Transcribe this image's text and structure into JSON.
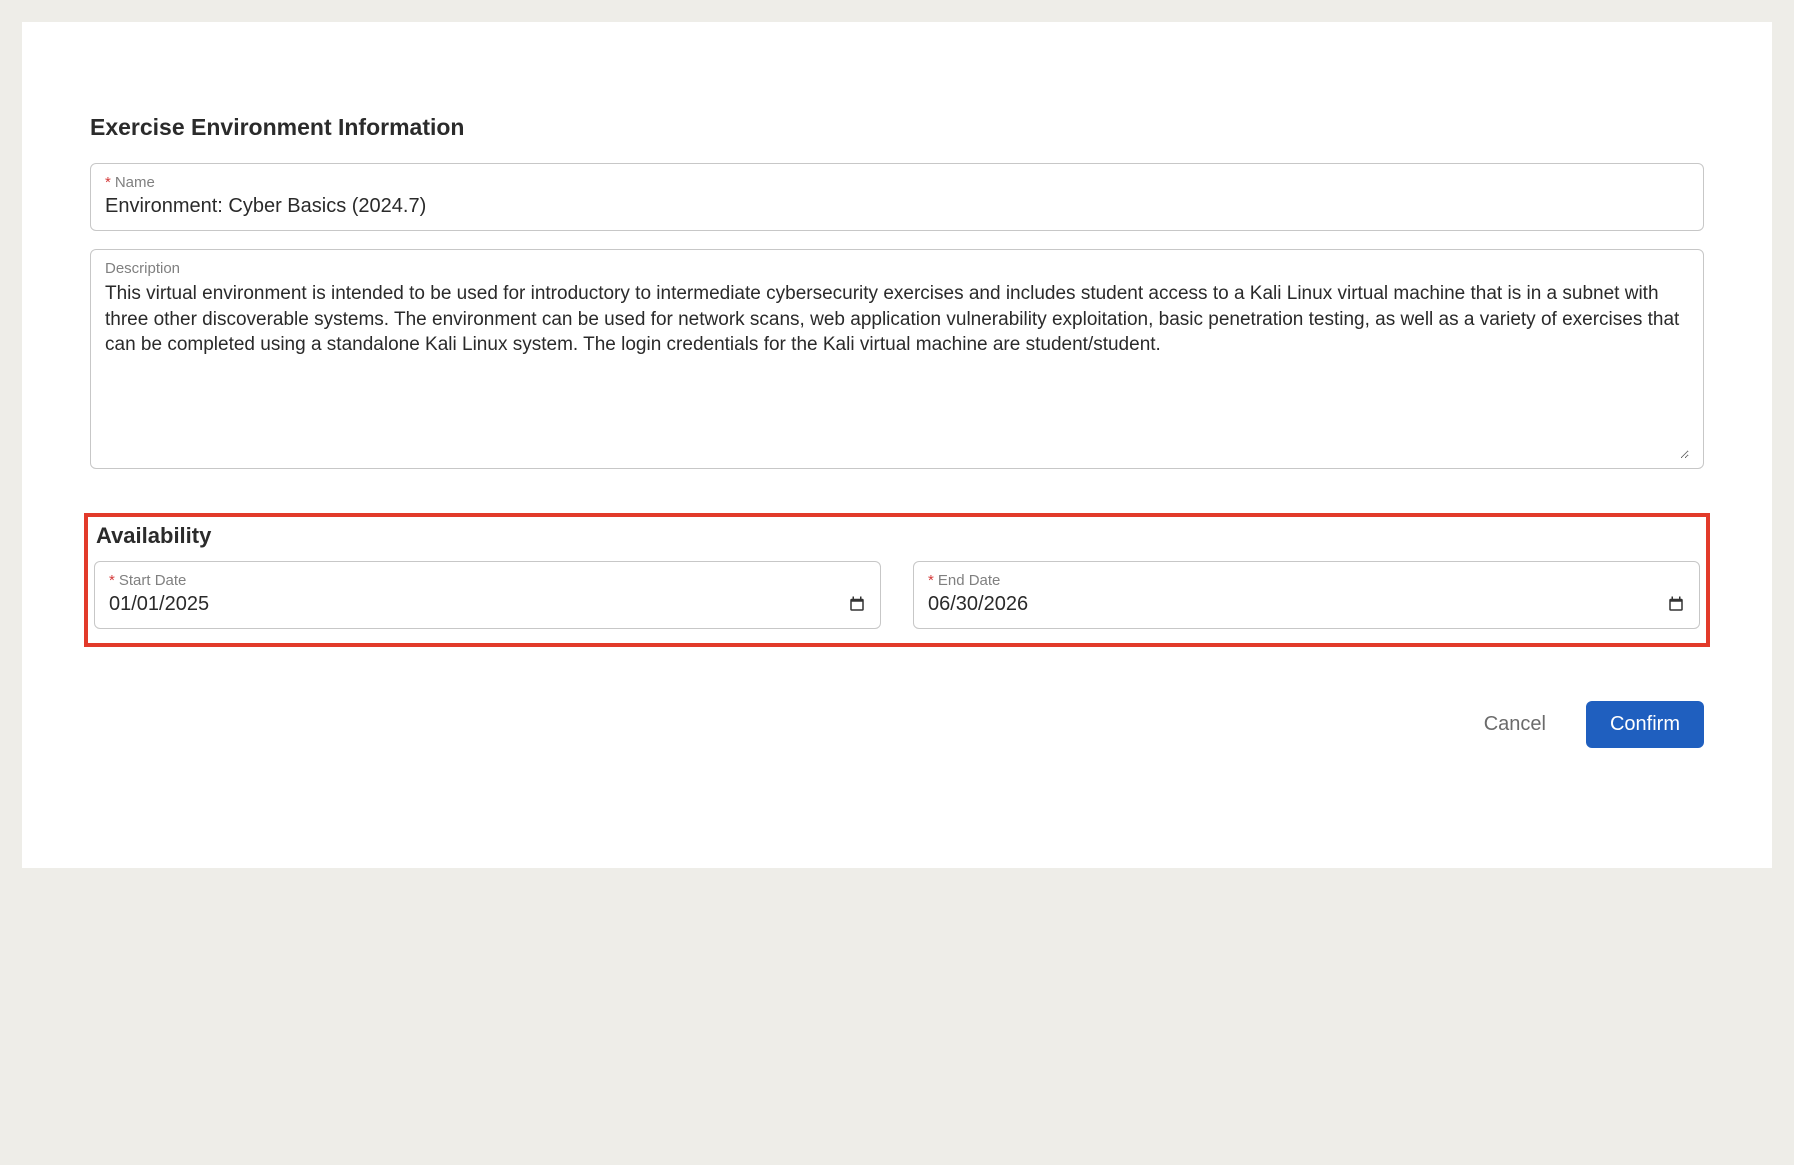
{
  "envInfo": {
    "heading": "Exercise Environment Information",
    "name": {
      "label": "Name",
      "required": true,
      "value": "Environment: Cyber Basics (2024.7)"
    },
    "description": {
      "label": "Description",
      "required": false,
      "value": "This virtual environment is intended to be used for introductory to intermediate cybersecurity exercises and includes student access to a Kali Linux virtual machine that is in a subnet with three other discoverable systems. The environment can be used for network scans, web application vulnerability exploitation, basic penetration testing, as well as a variety of exercises that can be completed using a standalone Kali Linux system. The login credentials for the Kali virtual machine are student/student."
    }
  },
  "availability": {
    "heading": "Availability",
    "startDate": {
      "label": "Start Date",
      "required": true,
      "value": "01/01/2025"
    },
    "endDate": {
      "label": "End Date",
      "required": true,
      "value": "06/30/2026"
    }
  },
  "actions": {
    "cancel": "Cancel",
    "confirm": "Confirm"
  },
  "asterisk": "*"
}
